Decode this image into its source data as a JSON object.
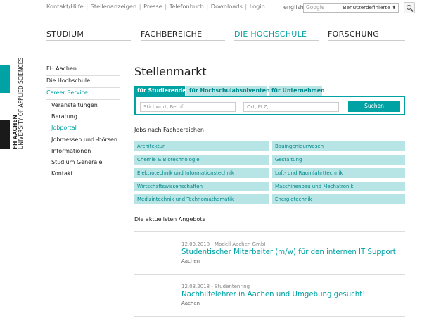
{
  "topbar": {
    "links": [
      "Kontakt/Hilfe",
      "Stellenanzeigen",
      "Presse",
      "Telefonbuch",
      "Downloads",
      "Login"
    ],
    "language": "english",
    "search_placeholder": "Google",
    "search_select": "Benutzerdefinierte"
  },
  "mainnav": {
    "items": [
      {
        "label": "STUDIUM"
      },
      {
        "label": "FACHBEREICHE"
      },
      {
        "label": "DIE HOCHSCHULE"
      },
      {
        "label": "FORSCHUNG"
      }
    ]
  },
  "brand": {
    "line1": "FH AACHEN",
    "line2": "UNIVERSITY OF APPLIED SCIENCES",
    "teal": "#00a2a4"
  },
  "sidebar": {
    "items": [
      {
        "label": "FH Aachen"
      },
      {
        "label": "Die Hochschule"
      },
      {
        "label": "Career Service"
      }
    ],
    "subitems": [
      {
        "label": "Veranstaltungen"
      },
      {
        "label": "Beratung"
      },
      {
        "label": "Jobportal"
      },
      {
        "label": "Jobmessen und -börsen"
      },
      {
        "label": "Informationen"
      },
      {
        "label": "Studium Generale"
      },
      {
        "label": "Kontakt"
      }
    ]
  },
  "main": {
    "title": "Stellenmarkt",
    "tabs": [
      {
        "label": "für Studierende"
      },
      {
        "label": "für Hochschulabsolventen"
      },
      {
        "label": "für Unternehmen"
      }
    ],
    "search": {
      "keyword_placeholder": "Stichwort, Beruf, ...",
      "location_placeholder": "Ort, PLZ, ...",
      "button": "Suchen"
    },
    "jobs_heading": "Jobs nach Fachbereichen",
    "categories": [
      "Architektur",
      "Bauingenieurwesen",
      "Chemie & Biotechnologie",
      "Gestaltung",
      "Elektrotechnik und Informationstechnik",
      "Luft- und Raumfahrttechnik",
      "Wirtschaftswissenschaften",
      "Maschinenbau und Mechatronik",
      "Medizintechnik und Technomathematik",
      "Energietechnik"
    ],
    "offers_heading": "Die aktuellsten Angebote",
    "offers": [
      {
        "meta": "12.03.2018 - Modell Aachen GmbH",
        "title": "Studentischer Mitarbeiter (m/w) für den internen IT Support",
        "location": "Aachen"
      },
      {
        "meta": "12.03.2018 - Studentenring",
        "title": "Nachhilfelehrer in Aachen und Umgebung gesucht!",
        "location": "Aachen"
      }
    ]
  }
}
